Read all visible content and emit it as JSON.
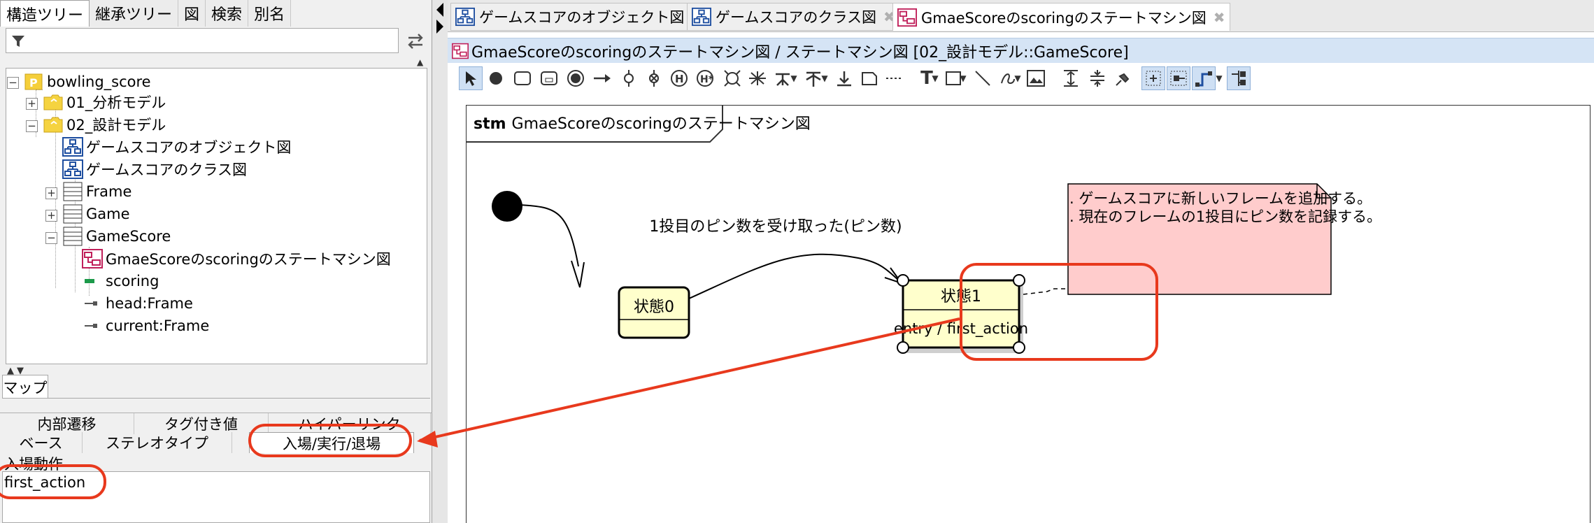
{
  "left_tabs": [
    "構造ツリー",
    "継承ツリー",
    "図",
    "検索",
    "別名"
  ],
  "tree": {
    "root": "bowling_score",
    "pkg_analysis": "01_分析モデル",
    "pkg_design": "02_設計モデル",
    "object_diagram": "ゲームスコアのオブジェクト図",
    "class_diagram": "ゲームスコアのクラス図",
    "frame": "Frame",
    "game": "Game",
    "gamescore": "GameScore",
    "statemachine": "GmaeScoreのscoringのステートマシン図",
    "scoring": "scoring",
    "head": "head:Frame",
    "current": "current:Frame"
  },
  "map_tab": "マップ",
  "prop_tabs_row1": [
    "内部遷移",
    "タグ付き値",
    "ハイパーリンク"
  ],
  "prop_tabs_row2": [
    "ベース",
    "ステレオタイプ",
    "入場/実行/退場"
  ],
  "entry_label": "入場動作",
  "entry_value": "first_action",
  "doc_tabs": [
    "ゲームスコアのオブジェクト図",
    "ゲームスコアのクラス図",
    "GmaeScoreのscoringのステートマシン図"
  ],
  "close_glyph": "✖",
  "diagram_title": "GmaeScoreのscoringのステートマシン図 / ステートマシン図 [02_設計モデル::GameScore]",
  "frame_keyword": "stm",
  "frame_name": "GmaeScoreのscoringのステートマシン図",
  "state0": "状態0",
  "state1": "状態1",
  "state1_entry": "entry / first_action",
  "transition_label": "1投目のピン数を受け取った(ピン数)",
  "note_lines": [
    ". ゲームスコアに新しいフレームを追加する。",
    ". 現在のフレームの1投目にピン数を記録する。"
  ],
  "colors": {
    "highlight": "#e8391d",
    "state_fill": "#ffffcc",
    "note_fill": "#ffcccc",
    "title_bar": "#d5e4f5"
  }
}
